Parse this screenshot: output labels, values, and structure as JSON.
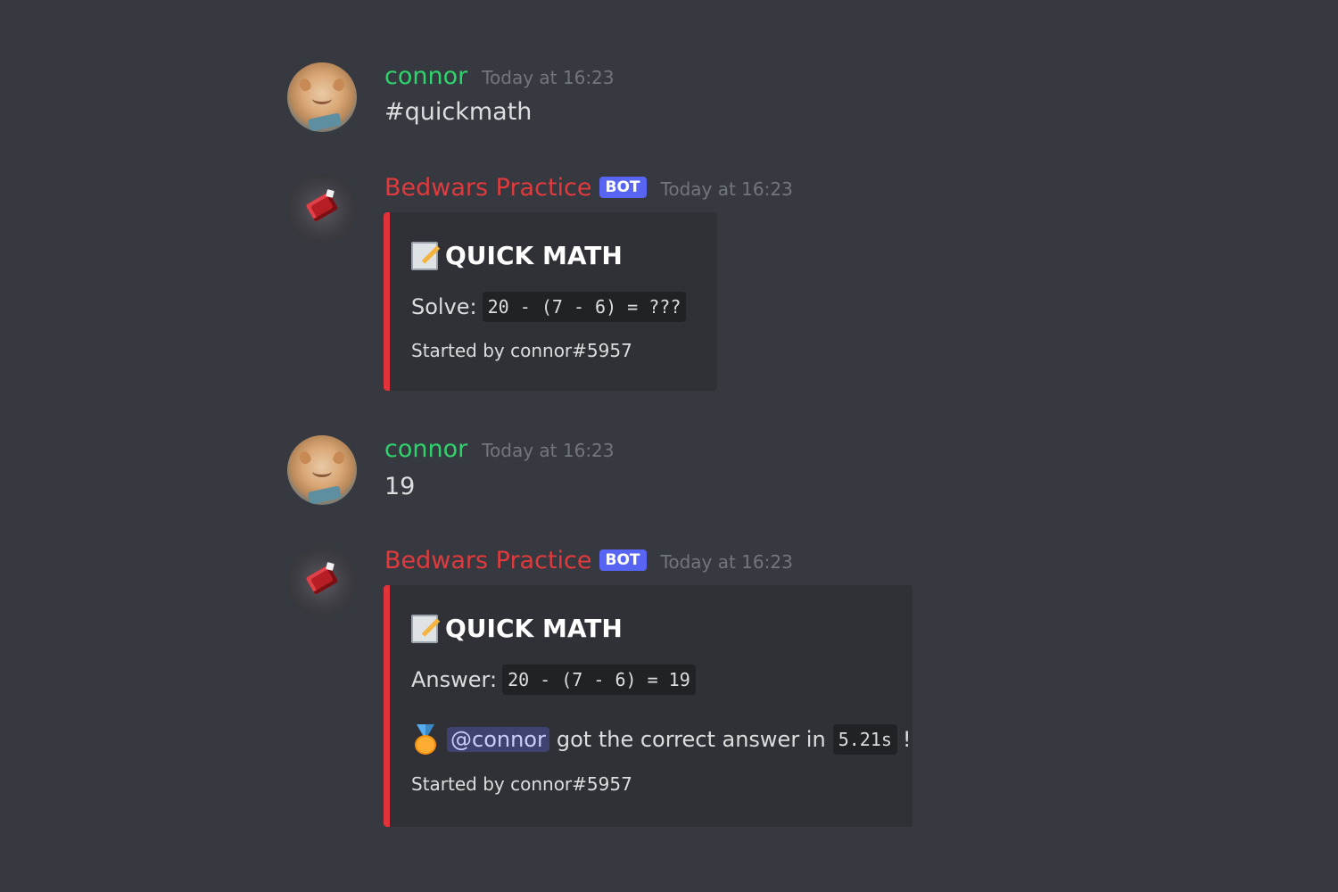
{
  "messages": [
    {
      "author": "connor",
      "timestamp": "Today at 16:23",
      "text": "#quickmath"
    },
    {
      "author": "Bedwars Practice",
      "badge": "BOT",
      "timestamp": "Today at 16:23",
      "embed": {
        "title": "QUICK MATH",
        "icon": "memo-icon",
        "label": "Solve:",
        "expression": "20 - (7 - 6) = ???",
        "footer": "Started by connor#5957",
        "accent_color": "#e0333c"
      }
    },
    {
      "author": "connor",
      "timestamp": "Today at 16:23",
      "text": "19"
    },
    {
      "author": "Bedwars Practice",
      "badge": "BOT",
      "timestamp": "Today at 16:23",
      "embed": {
        "title": "QUICK MATH",
        "icon": "memo-icon",
        "label": "Answer:",
        "expression": "20 - (7 - 6) = 19",
        "result": {
          "icon": "first-place-medal-icon",
          "mention": "@connor",
          "text": "got the correct answer in",
          "time": "5.21s",
          "suffix": "!"
        },
        "footer": "Started by connor#5957",
        "accent_color": "#e0333c"
      }
    }
  ],
  "colors": {
    "background": "#36393f",
    "user_name": "#2fd36d",
    "bot_name": "#e03a3e",
    "bot_badge": "#5865f2",
    "embed_bg": "#2f3136"
  }
}
